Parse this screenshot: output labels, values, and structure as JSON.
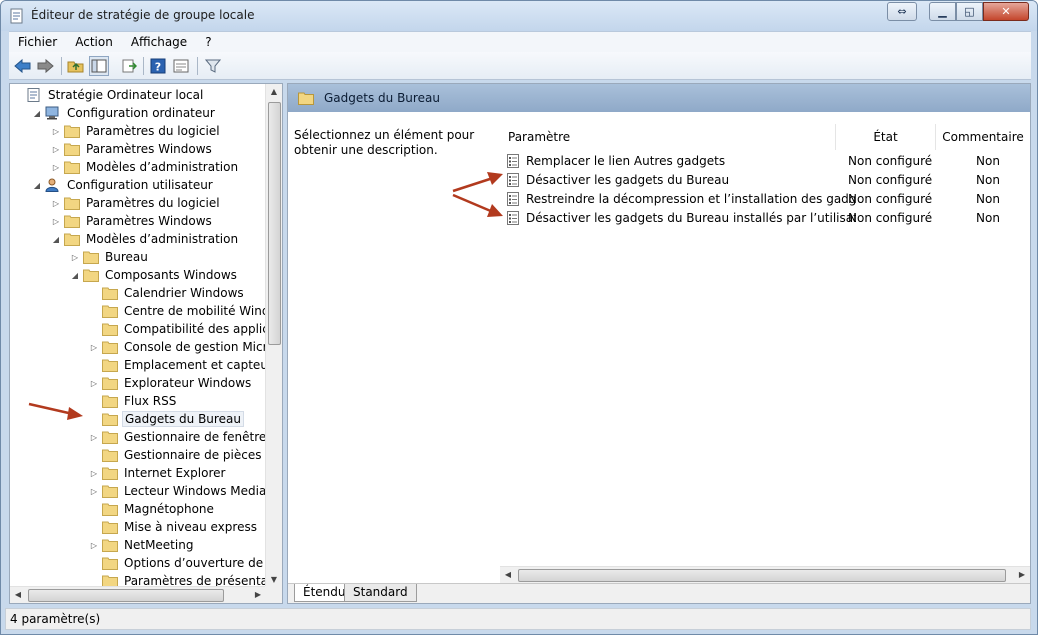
{
  "window": {
    "title": "Éditeur de stratégie de groupe locale"
  },
  "menubar": {
    "items": [
      "Fichier",
      "Action",
      "Affichage",
      "?"
    ]
  },
  "toolbar": {
    "buttons": [
      "back-icon",
      "forward-icon",
      "folder-up-icon",
      "show-hide-tree-icon",
      "export-list-icon",
      "help-icon",
      "properties-icon",
      "filter-icon"
    ]
  },
  "tree": {
    "items": [
      {
        "label": "Stratégie Ordinateur local",
        "expander": "",
        "icon": "policy"
      },
      {
        "label": "Configuration ordinateur",
        "expander": "◢",
        "icon": "computer"
      },
      {
        "label": "Paramètres du logiciel",
        "expander": "▷",
        "icon": "folder"
      },
      {
        "label": "Paramètres Windows",
        "expander": "▷",
        "icon": "folder"
      },
      {
        "label": "Modèles d’administration",
        "expander": "▷",
        "icon": "folder"
      },
      {
        "label": "Configuration utilisateur",
        "expander": "◢",
        "icon": "user"
      },
      {
        "label": "Paramètres du logiciel",
        "expander": "▷",
        "icon": "folder"
      },
      {
        "label": "Paramètres Windows",
        "expander": "▷",
        "icon": "folder"
      },
      {
        "label": "Modèles d’administration",
        "expander": "◢",
        "icon": "folder"
      },
      {
        "label": "Bureau",
        "expander": "▷",
        "icon": "folder"
      },
      {
        "label": "Composants Windows",
        "expander": "◢",
        "icon": "folder"
      },
      {
        "label": "Calendrier Windows",
        "expander": "",
        "icon": "folder"
      },
      {
        "label": "Centre de mobilité Windows",
        "expander": "",
        "icon": "folder"
      },
      {
        "label": "Compatibilité des applications",
        "expander": "",
        "icon": "folder"
      },
      {
        "label": "Console de gestion Microsoft",
        "expander": "▷",
        "icon": "folder"
      },
      {
        "label": "Emplacement et capteurs",
        "expander": "",
        "icon": "folder"
      },
      {
        "label": "Explorateur Windows",
        "expander": "▷",
        "icon": "folder"
      },
      {
        "label": "Flux RSS",
        "expander": "",
        "icon": "folder"
      },
      {
        "label": "Gadgets du Bureau",
        "expander": "",
        "icon": "folder",
        "selected": true
      },
      {
        "label": "Gestionnaire de fenêtres du Bureau",
        "expander": "▷",
        "icon": "folder"
      },
      {
        "label": "Gestionnaire de pièces jointes",
        "expander": "",
        "icon": "folder"
      },
      {
        "label": "Internet Explorer",
        "expander": "▷",
        "icon": "folder"
      },
      {
        "label": "Lecteur Windows Media",
        "expander": "▷",
        "icon": "folder"
      },
      {
        "label": "Magnétophone",
        "expander": "",
        "icon": "folder"
      },
      {
        "label": "Mise à niveau express",
        "expander": "",
        "icon": "folder"
      },
      {
        "label": "NetMeeting",
        "expander": "▷",
        "icon": "folder"
      },
      {
        "label": "Options d’ouverture de session Windows",
        "expander": "",
        "icon": "folder"
      },
      {
        "label": "Paramètres de présentation",
        "expander": "",
        "icon": "folder"
      }
    ]
  },
  "right": {
    "header_title": "Gadgets du Bureau",
    "description": "Sélectionnez un élément pour obtenir une description.",
    "columns": {
      "name": "Paramètre",
      "state": "État",
      "comment": "Commentaire"
    },
    "rows": [
      {
        "name": "Remplacer le lien Autres gadgets",
        "state": "Non configuré",
        "comment": "Non"
      },
      {
        "name": "Désactiver les gadgets du Bureau",
        "state": "Non configuré",
        "comment": "Non"
      },
      {
        "name": "Restreindre la décompression et l’installation des gadgets...",
        "state": "Non configuré",
        "comment": "Non"
      },
      {
        "name": "Désactiver les gadgets du Bureau installés par l’utilisateur",
        "state": "Non configuré",
        "comment": "Non"
      }
    ],
    "tabs": [
      "Étendu",
      "Standard"
    ]
  },
  "status": {
    "text": "4 paramètre(s)"
  },
  "colors": {
    "annotation_arrow": "#b23a1e",
    "header_band": "#a9c0da",
    "window_frame": "#c8d9ec"
  }
}
